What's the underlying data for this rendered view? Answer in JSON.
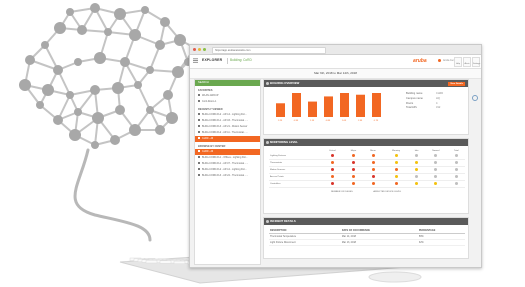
{
  "browser": {
    "url": "https://app.arubanetworks.com"
  },
  "app": {
    "title": "EXPLORER",
    "breadcrumb": "Building: CoRD",
    "logo": "aruba",
    "user_label": "Aruba Central",
    "top_icons": [
      "Help",
      "Alerts",
      "Settings"
    ]
  },
  "date_range": "Mar 6th, 2018 to Mar 14th, 2018",
  "sidebar": {
    "search_label": "SEARCH",
    "favorites_title": "FAVORITES",
    "favorites": [
      "WLAN-GROUP",
      "Conf-Room-1"
    ],
    "recent_title": "RECENTLY VIEWED",
    "recent": [
      "BLDG-CORD-FL2 - AP-14 - Lighting Fixt...",
      "BLDG-CORD-FL1 - AP-03 - Thermostat - ...",
      "BLDG-CORD-FL3 - AP-21 - Motion Sensor",
      "BLDG-CORD-FL2 - AP-11 - Thermostat - ...",
      "CoRD - All"
    ],
    "recent_selected": 4,
    "browse_title": "BROWSE BY CENTER",
    "browse": [
      "CoRD - All",
      "BLDG-CORD-FL1 - Offices - Lighting Fixt...",
      "BLDG-CORD-FL1 - AP-07 - Thermostat - ...",
      "BLDG-CORD-FL2 - AP-12 - Lighting Fixt...",
      "BLDG-CORD-FL3 - AP-22 - Thermostat - ..."
    ],
    "browse_selected": 0
  },
  "overview": {
    "title": "BUILDING OVERVIEW",
    "badge": "View Details",
    "bar_values": [
      8,
      14,
      9,
      12,
      14,
      13,
      14
    ],
    "stats": [
      "1.2K",
      "0.9K",
      "1.1K",
      "0.8K",
      "1.0K",
      "1.3K",
      "0.7K"
    ],
    "info_rows": [
      {
        "label": "Building name",
        "value": "CoRD"
      },
      {
        "label": "Campus name",
        "value": "HQ"
      },
      {
        "label": "Floors",
        "value": "4"
      },
      {
        "label": "Total APs",
        "value": "312"
      }
    ]
  },
  "monitoring": {
    "title": "MONITORING LEVEL",
    "columns": [
      "Critical",
      "Major",
      "Minor",
      "Warning",
      "Info",
      "Normal",
      "Total"
    ],
    "rows": [
      {
        "label": "Lighting Fixtures",
        "levels": [
          "r",
          "o",
          "o",
          "y",
          "g",
          "g",
          "g"
        ]
      },
      {
        "label": "Thermostats",
        "levels": [
          "o",
          "r",
          "o",
          "y",
          "y",
          "g",
          "g"
        ]
      },
      {
        "label": "Motion Sensors",
        "levels": [
          "r",
          "r",
          "o",
          "o",
          "y",
          "g",
          "g"
        ]
      },
      {
        "label": "Access Points",
        "levels": [
          "o",
          "o",
          "r",
          "y",
          "g",
          "g",
          "g"
        ]
      },
      {
        "label": "Controllers",
        "levels": [
          "r",
          "o",
          "o",
          "o",
          "y",
          "y",
          "g"
        ]
      }
    ],
    "legend": [
      "NUMBER OF ISSUES",
      "AFFECTED DEVICE LEVEL"
    ]
  },
  "events": {
    "title": "INCIDENT DETAILS",
    "headers": [
      "DESCRIPTION",
      "DATE OF OCCURRENCE",
      "PERCENTAGE"
    ],
    "rows": [
      {
        "desc": "Thermostat Temperature",
        "date": "Mar 14, 2018",
        "pct": "58%"
      },
      {
        "desc": "Light Fixture Disconnect",
        "date": "Mar 13, 2018",
        "pct": "32%"
      }
    ]
  },
  "colors": {
    "accent": "#f26722",
    "green": "#6aa84f",
    "header": "#5a5a5a",
    "red": "#d9342b",
    "orange": "#f26722",
    "yellow": "#f4c20d",
    "ok": "#bfbfbf"
  },
  "icons": [
    "brain-network-icon",
    "keyboard-icon",
    "menu-icon",
    "help-icon",
    "bell-icon",
    "gear-icon"
  ]
}
